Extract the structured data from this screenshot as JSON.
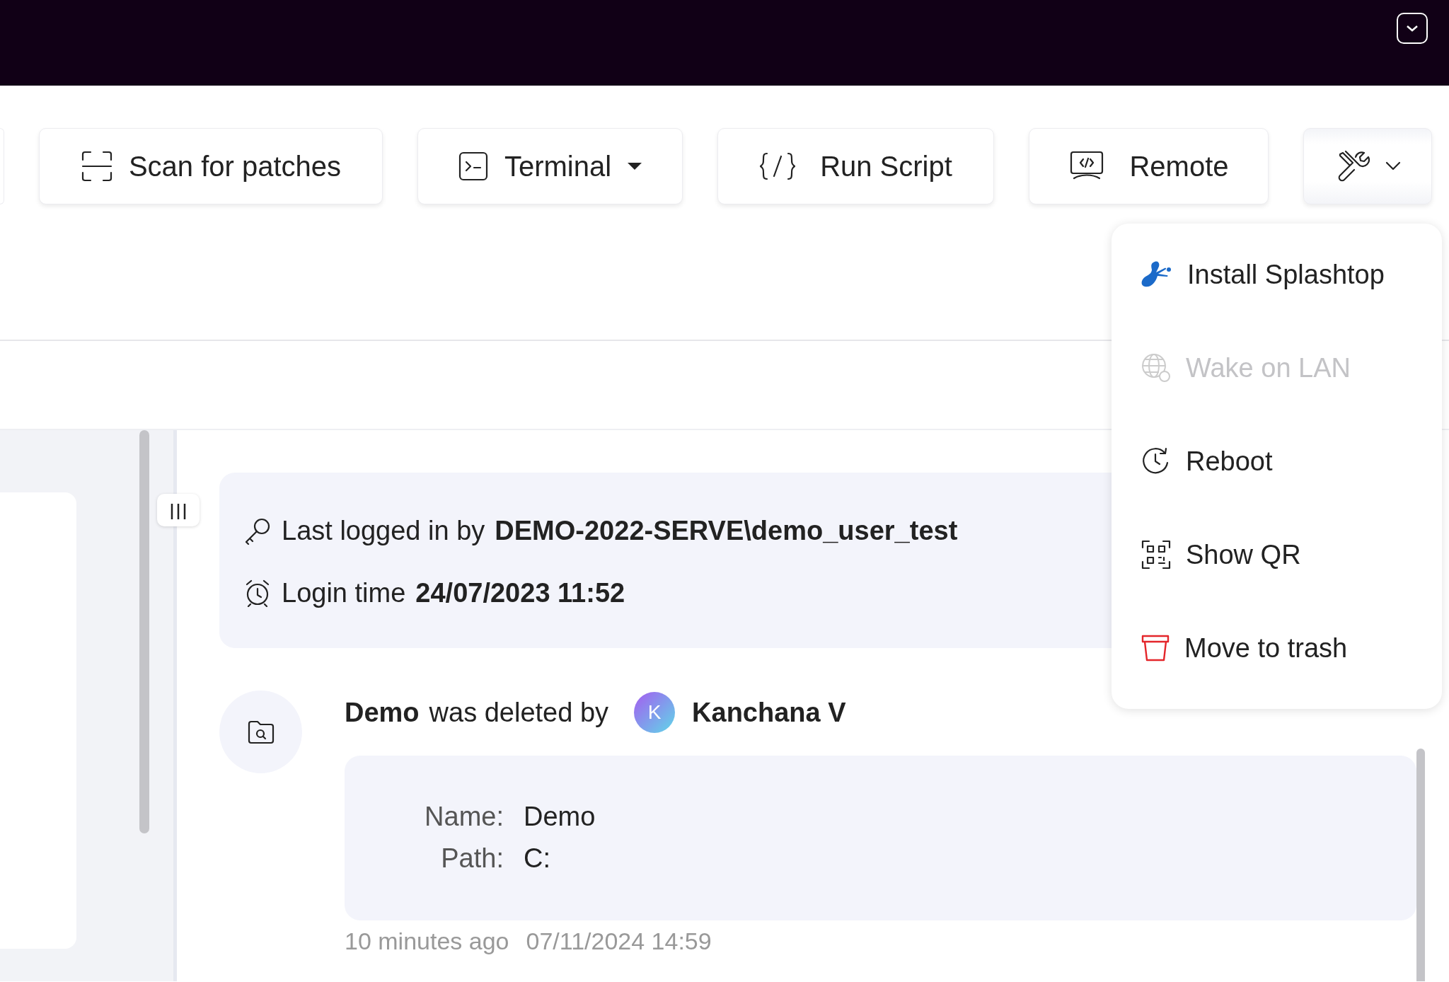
{
  "toolbar": {
    "buttons": [
      {
        "label": "Scan for patches",
        "kind": "plain"
      },
      {
        "label": "Terminal",
        "kind": "split"
      },
      {
        "label": "Run Script",
        "kind": "plain"
      },
      {
        "label": "Remote",
        "kind": "plain"
      },
      {
        "kind": "menu",
        "expanded": true
      }
    ]
  },
  "menu": {
    "items": [
      {
        "label": "Install Splashtop",
        "disabled": false
      },
      {
        "label": "Wake on LAN",
        "disabled": true
      },
      {
        "label": "Reboot",
        "disabled": false
      },
      {
        "label": "Show QR",
        "disabled": false
      },
      {
        "label": "Move to trash",
        "disabled": false
      }
    ]
  },
  "login": {
    "user_label": "Last logged in by",
    "user": "DEMO-2022-SERVE\\demo_user_test",
    "time_label": "Login time",
    "time": "24/07/2023 11:52"
  },
  "event": {
    "subject": "Demo",
    "action": "was deleted by",
    "avatar": "K",
    "actor": "Kanchana V",
    "details": [
      {
        "label": "Name:",
        "value": "Demo"
      },
      {
        "label": "Path:",
        "value": "C:"
      }
    ],
    "ago": "10 minutes ago",
    "timestamp": "07/11/2024 14:59"
  }
}
